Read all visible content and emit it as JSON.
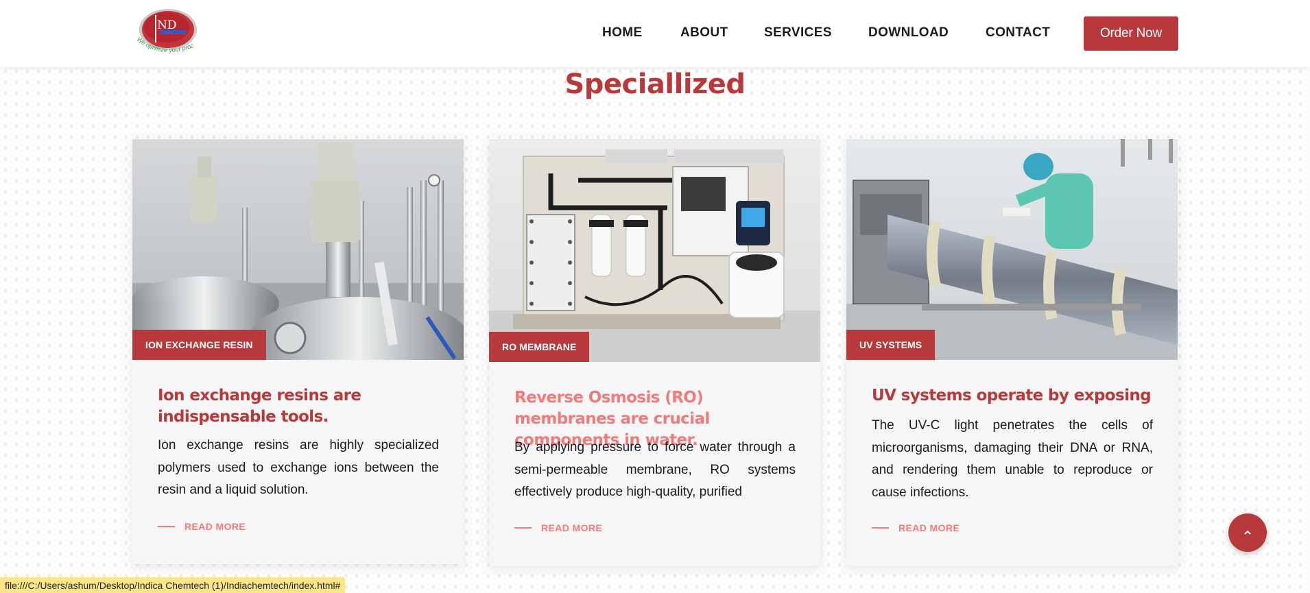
{
  "header": {
    "logo": {
      "text": "IND",
      "tagline": "We optimize your process"
    },
    "nav": [
      {
        "label": "HOME"
      },
      {
        "label": "ABOUT"
      },
      {
        "label": "SERVICES"
      },
      {
        "label": "DOWNLOAD"
      },
      {
        "label": "CONTACT"
      }
    ],
    "cta_label": "Order Now"
  },
  "section": {
    "title": "Speciallized"
  },
  "cards": [
    {
      "tag": "ION EXCHANGE RESIN",
      "title": "Ion exchange resins are indispensable tools.",
      "title_color": "#b8393c",
      "text": "Ion exchange resins are highly specialized polymers used to exchange ions between the resin and a liquid solution.",
      "read_more": "READ MORE",
      "image_icon": "stainless-steel-reactor-photo"
    },
    {
      "tag": "RO MEMBRANE",
      "title": "Reverse Osmosis (RO) membranes are crucial components in water.",
      "title_color": "#ee7c7c",
      "text": "By applying pressure to force water through a semi-permeable membrane, RO systems effectively produce high-quality, purified",
      "read_more": "READ MORE",
      "image_icon": "ro-filtration-unit-photo"
    },
    {
      "tag": "UV SYSTEMS",
      "title": "UV systems operate by exposing",
      "title_color": "#b8393c",
      "text": "The UV-C light penetrates the cells of microorganisms, damaging their DNA or RNA, and rendering them unable to reproduce or cause infections.",
      "read_more": "READ MORE",
      "image_icon": "uv-tunnel-lab-photo"
    }
  ],
  "scroll_top": {
    "icon": "chevron-up-icon"
  },
  "status_bar": {
    "url": "file:///C:/Users/ashum/Desktop/Indica Chemtech (1)/Indiachemtech/index.html#"
  },
  "colors": {
    "brand": "#b8393c",
    "accent_light": "#ee7c7c",
    "status_bg": "#fde68a"
  }
}
